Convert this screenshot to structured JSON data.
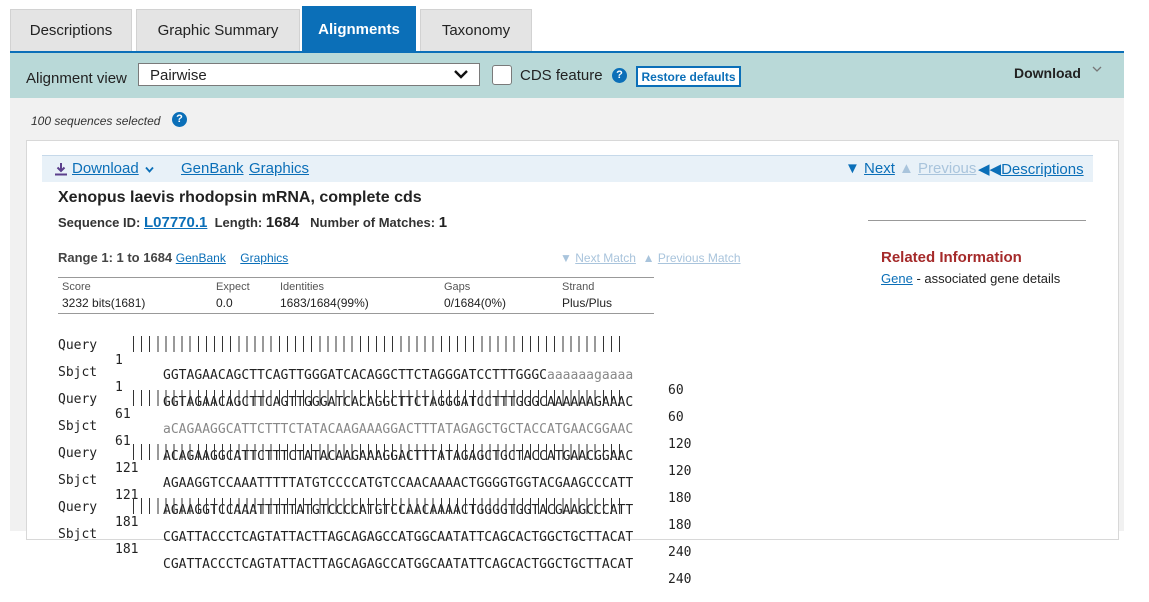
{
  "tabs": [
    {
      "label": "Descriptions"
    },
    {
      "label": "Graphic Summary"
    },
    {
      "label": "Alignments"
    },
    {
      "label": "Taxonomy"
    }
  ],
  "toolbar": {
    "alignment_view_label": "Alignment view",
    "alignment_view_value": "Pairwise",
    "cds_feature_label": "CDS feature",
    "cds_checked": false,
    "restore_defaults_label": "Restore defaults",
    "download_label": "Download"
  },
  "sequences_selected": "100 sequences selected",
  "result": {
    "download_label": "Download",
    "genbank_label": "GenBank",
    "graphics_label": "Graphics",
    "next_label": "Next",
    "previous_label": "Previous",
    "descriptions_label": "Descriptions",
    "title": "Xenopus laevis rhodopsin mRNA, complete cds",
    "sequence_id_label": "Sequence ID:",
    "sequence_id": "L07770.1",
    "length_label": "Length:",
    "length": "1684",
    "matches_label": "Number of Matches:",
    "matches": "1",
    "range_label": "Range 1: 1 to 1684",
    "range_genbank": "GenBank",
    "range_graphics": "Graphics",
    "next_match": "Next Match",
    "previous_match": "Previous Match",
    "stats": {
      "headers": [
        "Score",
        "Expect",
        "Identities",
        "Gaps",
        "Strand"
      ],
      "values": [
        "3232 bits(1681)",
        "0.0",
        "1683/1684(99%)",
        "0/1684(0%)",
        "Plus/Plus"
      ]
    },
    "related_title": "Related Information",
    "gene_link": "Gene",
    "gene_desc": "- associated gene details",
    "alignment": [
      {
        "qstart": "1",
        "qseq_upper": "GGTAGAACAGCTTCAGTTGGGATCACAGGCTTCTAGGGATCCTTTGGGC",
        "qseq_lower": "aaaaaagaaaa",
        "qend": "60",
        "sstart": "1",
        "sseq": "GGTAGAACAGCTTCAGTTGGGATCACAGGCTTCTAGGGATCCTTTGGGCAAAAAAGAAAC",
        "send": "60"
      },
      {
        "qstart": "61",
        "qseq_lower": "a",
        "qseq_upper": "CAGAAGGCATTCTTTCTATACAAGAAAGGACTTTATAGAGCTGCTACCATGAACGGAAC",
        "qend": "120",
        "sstart": "61",
        "sseq": "ACAGAAGGCATTCTTTCTATACAAGAAAGGACTTTATAGAGCTGCTACCATGAACGGAAC",
        "send": "120"
      },
      {
        "qstart": "121",
        "qseq_upper": "AGAAGGTCCAAATTTTTATGTCCCCATGTCCAACAAAACTGGGGTGGTACGAAGCCCATT",
        "qend": "180",
        "sstart": "121",
        "sseq": "AGAAGGTCCAAATTTTTATGTCCCCATGTCCAACAAAACTGGGGTGGTACGAAGCCCATT",
        "send": "180"
      },
      {
        "qstart": "181",
        "qseq_upper": "CGATTACCCTCAGTATTACTTAGCAGAGCCATGGCAATATTCAGCACTGGCTGCTTACAT",
        "qend": "240",
        "sstart": "181",
        "sseq": "CGATTACCCTCAGTATTACTTAGCAGAGCCATGGCAATATTCAGCACTGGCTGCTTACAT",
        "send": "240"
      }
    ],
    "query_label": "Query",
    "sbjct_label": "Sbjct"
  },
  "colors": {
    "accent": "#0b6fb8",
    "toolbar_bg": "#b9d9d8",
    "related": "#a52a2a"
  },
  "icons": [
    "chevron-down-icon",
    "help-icon",
    "download-icon",
    "triangle-down-icon",
    "triangle-up-icon",
    "rewind-icon"
  ]
}
